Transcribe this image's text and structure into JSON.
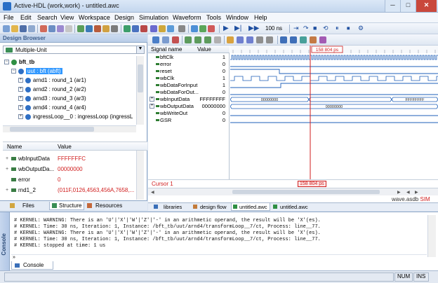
{
  "window": {
    "title": "Active-HDL  (work,work) - untitled.awc",
    "minimize": "─",
    "maximize": "□",
    "close": "✕"
  },
  "menu": [
    "File",
    "Edit",
    "Search",
    "View",
    "Workspace",
    "Design",
    "Simulation",
    "Waveform",
    "Tools",
    "Window",
    "Help"
  ],
  "toolbar": {
    "sim_time": "100 ns"
  },
  "design_browser": {
    "title": "Design Browser",
    "dropdown_value": "Multiple-Unit",
    "tree": [
      {
        "label": "bft_tb",
        "level": 0,
        "expanded": true
      },
      {
        "label": "uut : bft (abft)",
        "level": 1,
        "expanded": true,
        "selected": true
      },
      {
        "label": "arnd1 : round_1 (ar1)",
        "level": 2
      },
      {
        "label": "arnd2 : round_2 (ar2)",
        "level": 2
      },
      {
        "label": "arnd3 : round_3 (ar3)",
        "level": 2
      },
      {
        "label": "arnd4 : round_4 (ar4)",
        "level": 2
      },
      {
        "label": "ingressLoop__0 : ingressLoop (ingressL",
        "level": 2
      }
    ],
    "grid_headers": {
      "name": "Name",
      "value": "Value"
    },
    "grid_rows": [
      {
        "expander": "+",
        "name": "wbInputData",
        "value": "FFFFFFFC"
      },
      {
        "expander": "+",
        "name": "wbOutputDa...",
        "value": "00000000"
      },
      {
        "expander": "",
        "name": "error",
        "value": "0"
      },
      {
        "expander": "+",
        "name": "rnd1_2",
        "value": "(011F,0126,4563,456A,7658,..."
      }
    ],
    "tabs": [
      "Files",
      "Structure",
      "Resources"
    ]
  },
  "waveform": {
    "header_name": "Signal name",
    "header_value": "Value",
    "signals": [
      {
        "name": "bftClk",
        "value": "1",
        "expander": ""
      },
      {
        "name": "error",
        "value": "0",
        "expander": ""
      },
      {
        "name": "reset",
        "value": "0",
        "expander": ""
      },
      {
        "name": "wbClk",
        "value": "1",
        "expander": ""
      },
      {
        "name": "wbDataForInput",
        "value": "1",
        "expander": ""
      },
      {
        "name": "wbDataForOut...",
        "value": "0",
        "expander": ""
      },
      {
        "name": "wbInputData",
        "value": "FFFFFFFF",
        "expander": "+"
      },
      {
        "name": "wbOutputData",
        "value": "00000000",
        "expander": "+"
      },
      {
        "name": "wbWriteOut",
        "value": "0",
        "expander": ""
      },
      {
        "name": "GSR",
        "value": "0",
        "expander": ""
      }
    ],
    "cursor_label": "Cursor 1",
    "cursor_time": "158 804 ps",
    "bus_values": {
      "input_left": "00000000",
      "input_right": "FFFFFFFF",
      "output": "00000000"
    },
    "status_text": "wave.asdb",
    "status_sim": "SIM"
  },
  "doc_tabs": [
    "libraries",
    "design flow",
    "untitled.awc",
    "untitled.awc"
  ],
  "console": {
    "side_label": "Console",
    "lines": [
      "# KERNEL: WARNING: There is an 'U'|'X'|'W'|'Z'|'-' in an arithmetic operand, the result will be 'X'(es).",
      "# KERNEL: Time: 30 ns,  Iteration: 1,  Instance: /bft_tb/uut/arnd4/transformLoop__7/ct,  Process: line__77.",
      "# KERNEL: WARNING: There is an 'U'|'X'|'W'|'Z'|'-' in an arithmetic operand, the result will be 'X'(es).",
      "# KERNEL: Time: 30 ns,  Iteration: 1,  Instance: /bft_tb/uut/arnd4/transformLoop__7/ct,  Process: line__77.",
      "# KERNEL: stopped at time: 1 us"
    ],
    "prompt": "»",
    "tab": "Console"
  },
  "statusbar": {
    "num": "NUM",
    "ins": "INS"
  }
}
